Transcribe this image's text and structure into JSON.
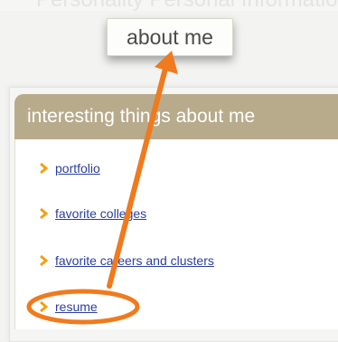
{
  "top_clipped_text": "Personality Personal Information",
  "about_button": {
    "label": "about me"
  },
  "panel": {
    "title": "interesting things about me",
    "links": [
      {
        "label": "portfolio"
      },
      {
        "label": "favorite colleges"
      },
      {
        "label": "favorite careers and clusters"
      },
      {
        "label": "resume"
      }
    ]
  },
  "annotation": {
    "color": "#f07a1e"
  },
  "icons": {
    "link_bullet": "chevron-right-icon"
  }
}
